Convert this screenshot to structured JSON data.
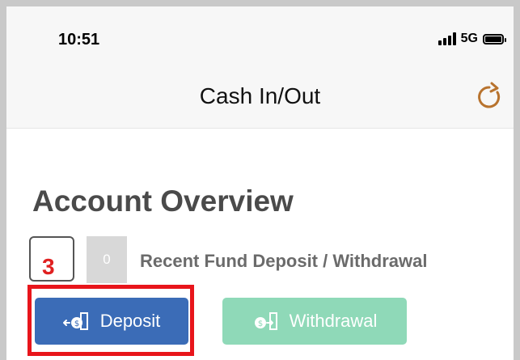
{
  "status_bar": {
    "time": "10:51",
    "network": "5G",
    "icons": [
      "signal-icon",
      "battery-icon"
    ]
  },
  "nav": {
    "title": "Cash In/Out",
    "refresh_icon": "refresh-icon"
  },
  "overview": {
    "title": "Account Overview",
    "step_number": "3",
    "recent_count": "0",
    "recent_label": "Recent Fund Deposit / Withdrawal"
  },
  "actions": {
    "deposit_label": "Deposit",
    "deposit_icon": "deposit-icon",
    "withdrawal_label": "Withdrawal",
    "withdrawal_icon": "withdrawal-icon"
  },
  "colors": {
    "deposit_button": "#3b6cb7",
    "withdrawal_button": "#8fd9b8",
    "highlight": "#e8151b",
    "step_number": "#e02020",
    "refresh": "#b8732e"
  }
}
